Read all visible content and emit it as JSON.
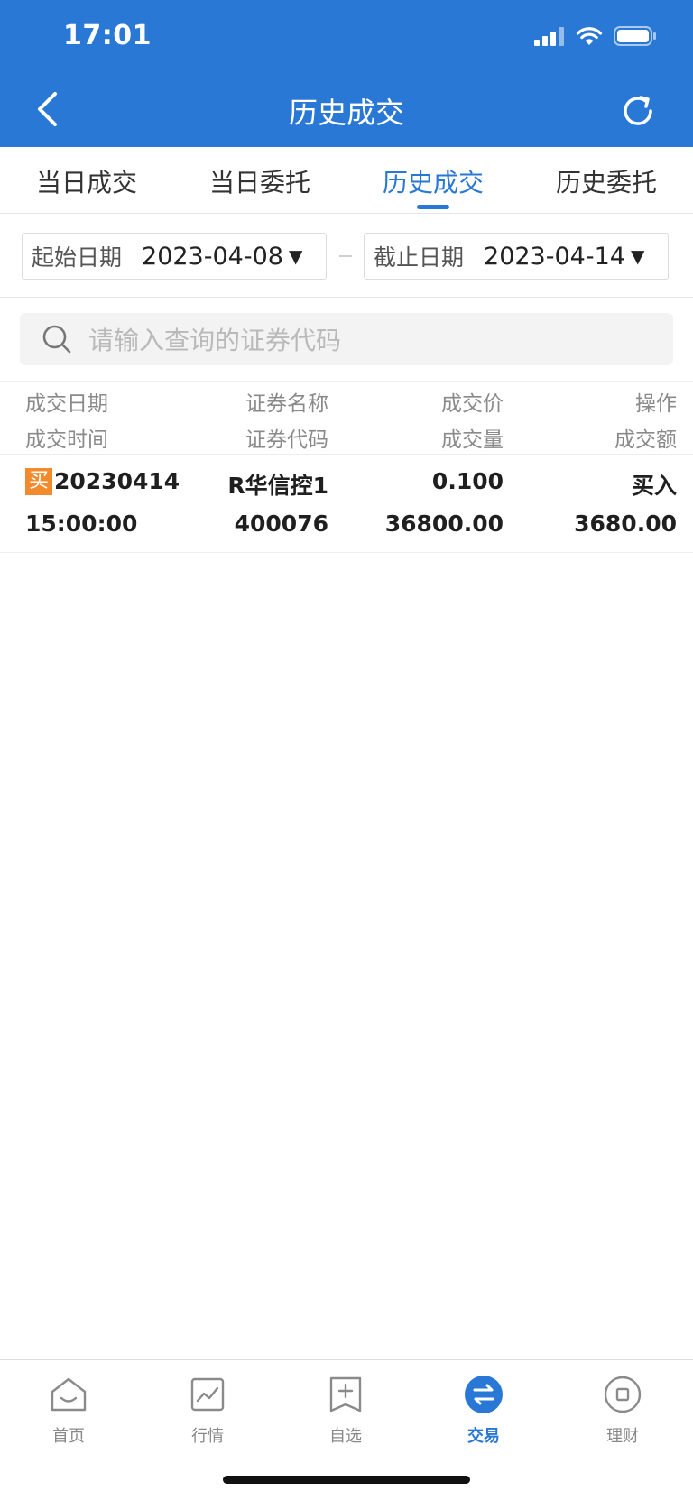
{
  "status_bar": {
    "time": "17:01"
  },
  "nav": {
    "title": "历史成交"
  },
  "tabs": [
    {
      "label": "当日成交",
      "active": false
    },
    {
      "label": "当日委托",
      "active": false
    },
    {
      "label": "历史成交",
      "active": true
    },
    {
      "label": "历史委托",
      "active": false
    }
  ],
  "date_range": {
    "start_label": "起始日期",
    "start_value": "2023-04-08",
    "end_label": "截止日期",
    "end_value": "2023-04-14"
  },
  "search": {
    "placeholder": "请输入查询的证券代码"
  },
  "table": {
    "headers": {
      "row1": [
        "成交日期",
        "证券名称",
        "成交价",
        "操作"
      ],
      "row2": [
        "成交时间",
        "证券代码",
        "成交量",
        "成交额"
      ]
    },
    "rows": [
      {
        "badge": "买",
        "date": "20230414",
        "name": "R华信控1",
        "price": "0.100",
        "action": "买入",
        "time": "15:00:00",
        "code": "400076",
        "volume": "36800.00",
        "amount": "3680.00"
      }
    ]
  },
  "bottom_nav": [
    {
      "label": "首页",
      "icon": "home-icon",
      "active": false
    },
    {
      "label": "行情",
      "icon": "chart-icon",
      "active": false
    },
    {
      "label": "自选",
      "icon": "add-bookmark-icon",
      "active": false
    },
    {
      "label": "交易",
      "icon": "swap-icon",
      "active": true
    },
    {
      "label": "理财",
      "icon": "coin-icon",
      "active": false
    }
  ],
  "colors": {
    "primary": "#2a78d5",
    "buy_badge": "#f28a2e"
  }
}
